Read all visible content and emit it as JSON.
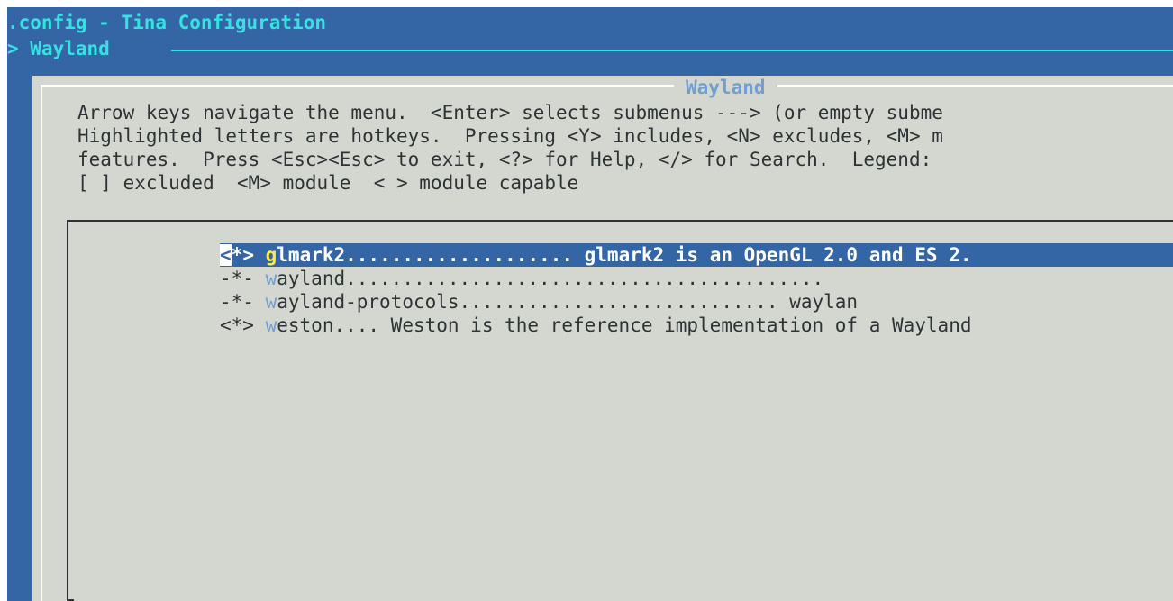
{
  "window": {
    "title": ".config - Tina Configuration",
    "breadcrumb": "> Wayland"
  },
  "dialog": {
    "title": "Wayland",
    "help_lines": [
      "Arrow keys navigate the menu.  <Enter> selects submenus ---> (or empty subme",
      "Highlighted letters are hotkeys.  Pressing <Y> includes, <N> excludes, <M> m",
      "features.  Press <Esc><Esc> to exit, <?> for Help, </> for Search.  Legend:",
      "[ ] excluded  <M> module  < > module capable"
    ]
  },
  "menu": {
    "items": [
      {
        "state_open": "<",
        "state_mark": "*",
        "state_close": ">",
        "hotkey": "g",
        "rest": "lmark2.................... glmark2 is an OpenGL 2.0 and ES 2.",
        "selected": true
      },
      {
        "state": "-*-",
        "hotkey": "w",
        "rest": "ayland..........................................",
        "selected": false
      },
      {
        "state": "-*-",
        "hotkey": "w",
        "rest": "ayland-protocols............................ waylan",
        "selected": false
      },
      {
        "state": "<*>",
        "hotkey": "w",
        "rest": "eston.... Weston is the reference implementation of a Wayland",
        "selected": false
      }
    ]
  },
  "colors": {
    "background": "#3465a4",
    "dialog": "#d3d7cf",
    "accent": "#34e2e2",
    "hotkey": "#729fcf",
    "selected_hotkey": "#fce94f"
  }
}
